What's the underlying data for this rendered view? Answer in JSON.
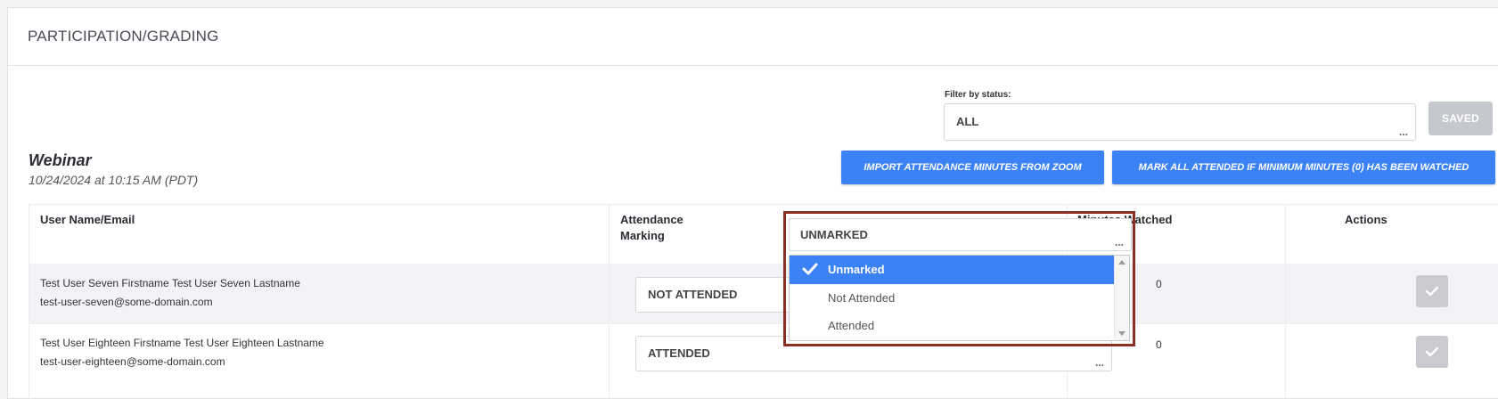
{
  "panel": {
    "title": "PARTICIPATION/GRADING"
  },
  "filter": {
    "label": "Filter by status:",
    "value": "ALL"
  },
  "saved_button": "SAVED",
  "session": {
    "title": "Webinar",
    "date": "10/24/2024 at 10:15 AM (PDT)"
  },
  "buttons": {
    "import": "IMPORT ATTENDANCE MINUTES FROM ZOOM",
    "mark_all": "MARK ALL ATTENDED IF MINIMUM MINUTES (0) HAS BEEN WATCHED"
  },
  "table": {
    "headers": {
      "user": "User Name/Email",
      "attendance_line1": "Attendance",
      "attendance_line2": "Marking",
      "minutes": "Minutes Watched",
      "actions": "Actions"
    },
    "rows": [
      {
        "name": "Test User Seven Firstname Test User Seven Lastname",
        "email": "test-user-seven@some-domain.com",
        "attendance": "NOT ATTENDED",
        "minutes": "0"
      },
      {
        "name": "Test User Eighteen Firstname Test User Eighteen Lastname",
        "email": "test-user-eighteen@some-domain.com",
        "attendance": "ATTENDED",
        "minutes": "0"
      }
    ]
  },
  "dropdown": {
    "current": "UNMARKED",
    "options": [
      "Unmarked",
      "Not Attended",
      "Attended"
    ],
    "selected": "Unmarked"
  },
  "ellipsis": "..."
}
